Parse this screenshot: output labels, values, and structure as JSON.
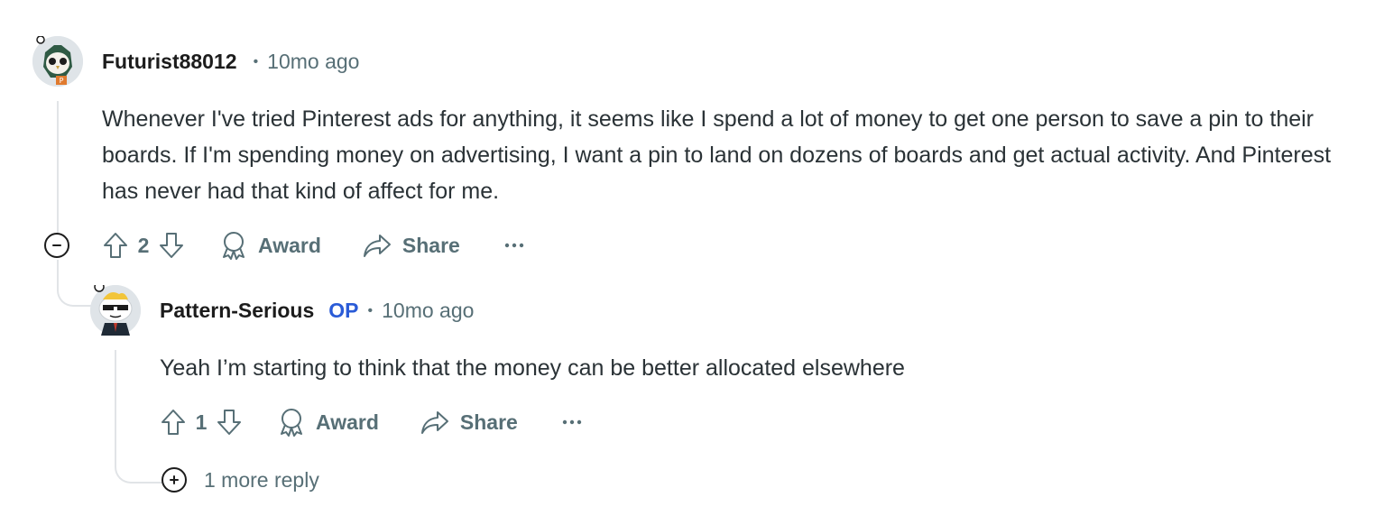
{
  "comments": [
    {
      "username": "Futurist88012",
      "separator": "•",
      "time": "10mo ago",
      "body": "Whenever I've tried Pinterest ads for anything, it seems like I spend a lot of money to get one person to save a pin to their boards. If I'm spending money on advertising, I want a pin to land on dozens of boards and get actual activity. And Pinterest has never had that kind of affect for me.",
      "score": "2",
      "award_label": "Award",
      "share_label": "Share"
    },
    {
      "username": "Pattern-Serious",
      "op_badge": "OP",
      "separator": "•",
      "time": "10mo ago",
      "body": "Yeah I’m starting to think that the money can be better allocated elsewhere",
      "score": "1",
      "award_label": "Award",
      "share_label": "Share"
    }
  ],
  "more_replies_label": "1 more reply",
  "icons": {
    "upvote": "upvote-arrow-icon",
    "downvote": "downvote-arrow-icon",
    "award": "award-ribbon-icon",
    "share": "share-arrow-icon",
    "more": "ellipsis-icon",
    "collapse": "minus-circle-icon",
    "expand": "plus-circle-icon"
  },
  "colors": {
    "text": "#2a3236",
    "meta": "#576f76",
    "op": "#2a5bd7",
    "thread_line": "#e1e4e7"
  }
}
